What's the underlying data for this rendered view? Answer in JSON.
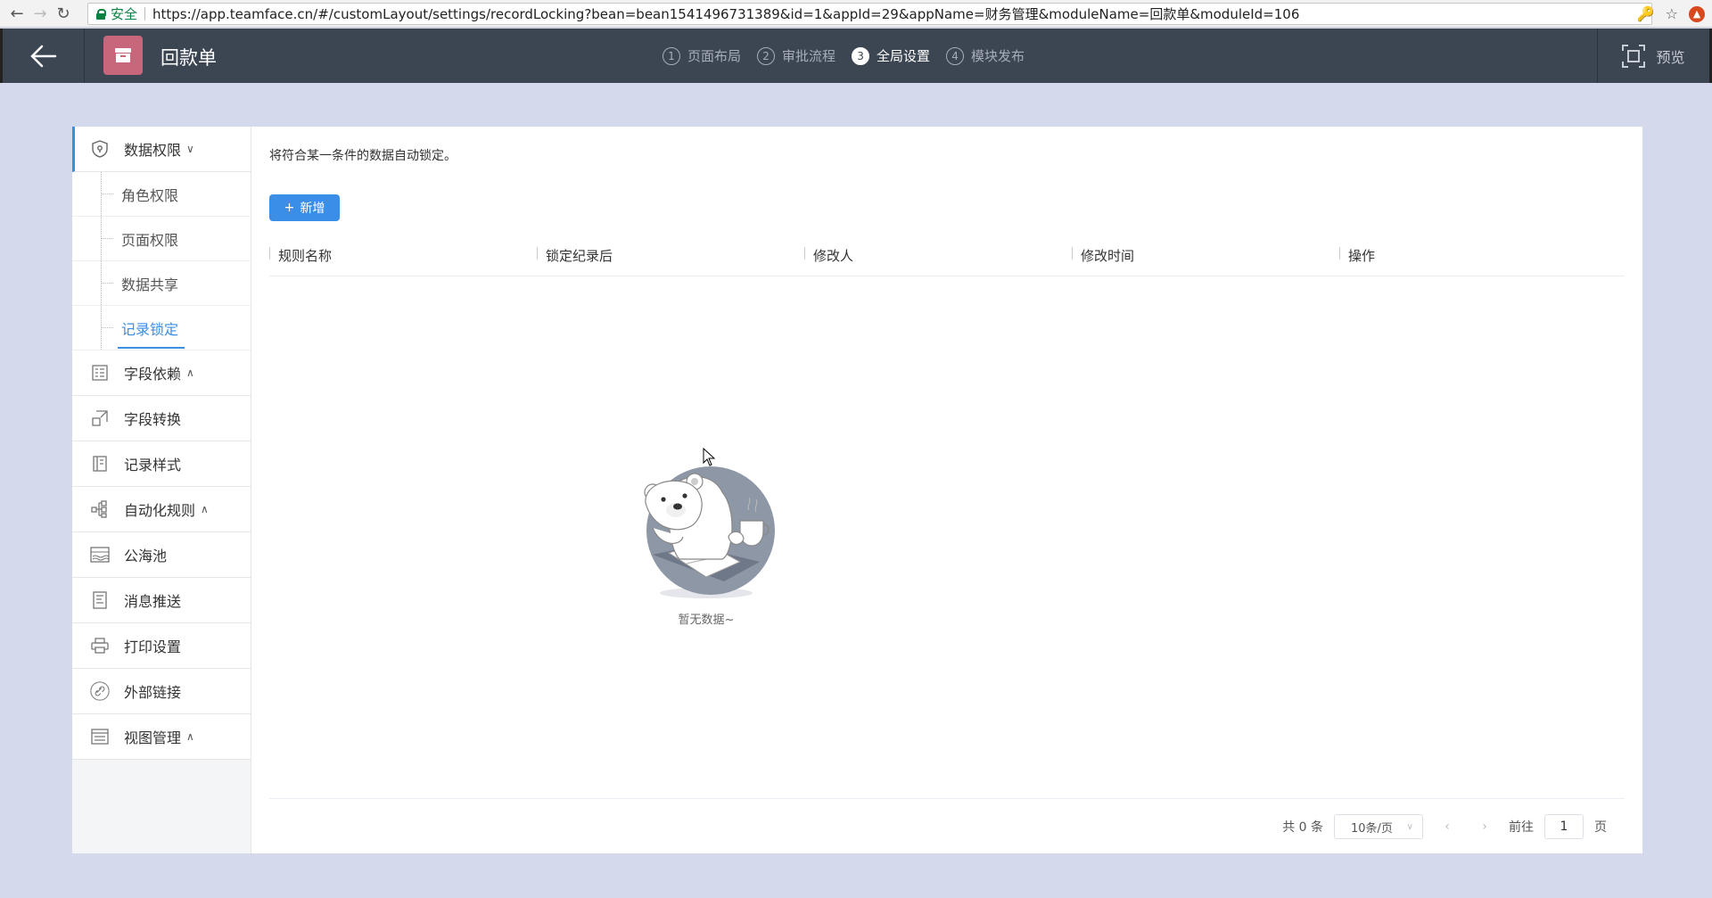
{
  "browser": {
    "secure_label": "安全",
    "url": "https://app.teamface.cn/#/customLayout/settings/recordLocking?bean=bean1541496731389&id=1&appId=29&appName=财务管理&moduleName=回款单&moduleId=106"
  },
  "header": {
    "title": "回款单",
    "steps": [
      {
        "num": "1",
        "label": "页面布局"
      },
      {
        "num": "2",
        "label": "审批流程"
      },
      {
        "num": "3",
        "label": "全局设置"
      },
      {
        "num": "4",
        "label": "模块发布"
      }
    ],
    "active_step": 3,
    "preview_label": "预览"
  },
  "sidebar": {
    "group": {
      "label": "数据权限",
      "icon": "shield-icon"
    },
    "subitems": [
      "角色权限",
      "页面权限",
      "数据共享",
      "记录锁定"
    ],
    "active_subitem": "记录锁定",
    "items": [
      {
        "label": "字段依赖",
        "icon": "field-dependency-icon",
        "chevron": "up"
      },
      {
        "label": "字段转换",
        "icon": "field-convert-icon"
      },
      {
        "label": "记录样式",
        "icon": "record-style-icon"
      },
      {
        "label": "自动化规则",
        "icon": "automation-icon",
        "chevron": "up"
      },
      {
        "label": "公海池",
        "icon": "pool-icon"
      },
      {
        "label": "消息推送",
        "icon": "message-push-icon"
      },
      {
        "label": "打印设置",
        "icon": "printer-icon"
      },
      {
        "label": "外部链接",
        "icon": "link-icon"
      },
      {
        "label": "视图管理",
        "icon": "view-management-icon",
        "chevron": "up"
      }
    ]
  },
  "content": {
    "description": "将符合某一条件的数据自动锁定。",
    "add_button": "新增",
    "columns": [
      "规则名称",
      "锁定纪录后",
      "修改人",
      "修改时间",
      "操作"
    ],
    "empty_text": "暂无数据~"
  },
  "pagination": {
    "total": "共 0 条",
    "page_size": "10条/页",
    "goto_label": "前往",
    "page_value": "1",
    "page_suffix": "页"
  },
  "colors": {
    "accent": "#3a8ee6",
    "header_bg": "#3c4552",
    "page_bg": "#d5d9ec",
    "module_icon_bg": "#c8677c"
  }
}
